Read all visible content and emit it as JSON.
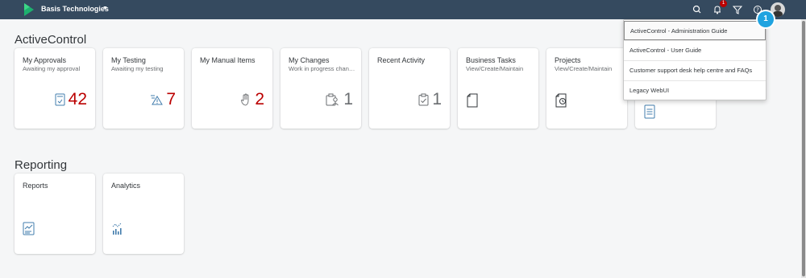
{
  "shell": {
    "company_name": "Basis Technologies",
    "notification_count": "1",
    "icons": [
      "search-icon",
      "bell-icon",
      "filter-icon",
      "help-icon",
      "user-avatar"
    ],
    "bar_color": "#354a5f"
  },
  "sections": {
    "activecontrol_title": "ActiveControl",
    "reporting_title": "Reporting"
  },
  "tiles": [
    {
      "title": "My Approvals",
      "subtitle": "Awaiting my approval",
      "kpi": "42",
      "icon": "approvals-icon"
    },
    {
      "title": "My Testing",
      "subtitle": "Awaiting my testing",
      "kpi": "7",
      "icon": "testing-warning-icon"
    },
    {
      "title": "My Manual Items",
      "subtitle": "",
      "kpi": "2",
      "icon": "hand-icon"
    },
    {
      "title": "My Changes",
      "subtitle": "Work in progress changes",
      "kpi": "1",
      "icon": "changes-icon"
    },
    {
      "title": "Recent Activity",
      "subtitle": "",
      "kpi": "1",
      "icon": "clipboard-icon"
    },
    {
      "title": "Business Tasks",
      "subtitle": "View/Create/Maintain",
      "kpi": "",
      "icon": "document-icon"
    },
    {
      "title": "Projects",
      "subtitle": "View/Create/Maintain",
      "kpi": "",
      "icon": "project-icon"
    }
  ],
  "reporting_tiles": [
    {
      "title": "Reports",
      "icon": "report-icon"
    },
    {
      "title": "Analytics",
      "icon": "analytics-icon"
    }
  ],
  "help_menu": {
    "items": [
      "ActiveControl - Administration Guide",
      "ActiveControl - User Guide",
      "Customer support desk help centre and FAQs",
      "Legacy WebUI"
    ]
  },
  "step_badge": "1",
  "colors": {
    "kpi_red": "#bb0000",
    "kpi_neutral": "#6a6d70",
    "accent_badge": "#1fa3e0"
  }
}
